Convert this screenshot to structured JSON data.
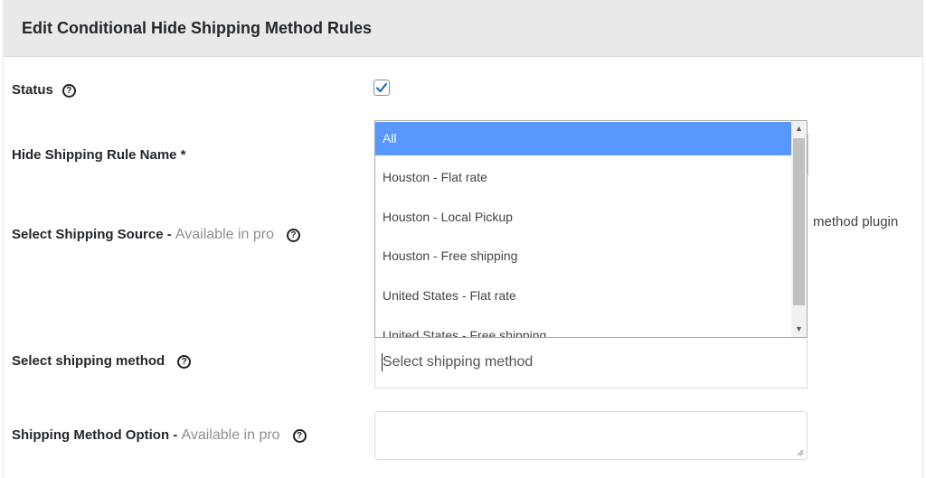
{
  "panel": {
    "title": "Edit Conditional Hide Shipping Method Rules"
  },
  "rows": {
    "status": {
      "label": "Status",
      "checked": true
    },
    "rule_name": {
      "label": "Hide Shipping Rule Name *"
    },
    "shipping_source": {
      "label": "Select Shipping Source - ",
      "pro": "Available in pro",
      "behind_text": "method plugin"
    },
    "shipping_method": {
      "label": "Select shipping method",
      "placeholder": "Select shipping method"
    },
    "method_option": {
      "label": "Shipping Method Option - ",
      "pro": "Available in pro"
    }
  },
  "dropdown": {
    "options": [
      "All",
      "Houston - Flat rate",
      "Houston - Local Pickup",
      "Houston - Free shipping",
      "United States - Flat rate",
      "United States - Free shipping"
    ],
    "highlighted": "All"
  },
  "icons": {
    "help": "help-circle-icon",
    "check": "checkmark-icon"
  },
  "colors": {
    "highlight": "#5897fb",
    "pro_text": "#8c8f94",
    "checkmark": "#2271b1"
  }
}
